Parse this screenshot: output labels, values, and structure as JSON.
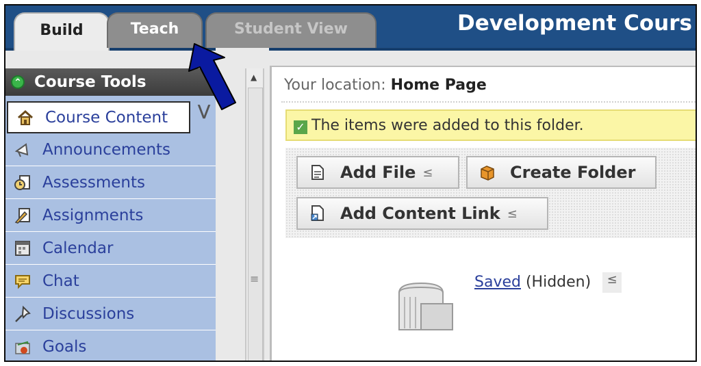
{
  "tabs": [
    {
      "label": "Build",
      "state": "active"
    },
    {
      "label": "Teach",
      "state": "inactive"
    },
    {
      "label": "Student View",
      "state": "disabled"
    }
  ],
  "course_title": "Development Cours",
  "sidebar": {
    "header": "Course Tools",
    "items": [
      {
        "label": "Course Content",
        "icon": "home-icon"
      },
      {
        "label": "Announcements",
        "icon": "megaphone-icon"
      },
      {
        "label": "Assessments",
        "icon": "clock-document-icon"
      },
      {
        "label": "Assignments",
        "icon": "pencil-document-icon"
      },
      {
        "label": "Calendar",
        "icon": "calendar-icon"
      },
      {
        "label": "Chat",
        "icon": "chat-bubble-icon"
      },
      {
        "label": "Discussions",
        "icon": "pushpin-icon"
      },
      {
        "label": "Goals",
        "icon": "target-icon"
      }
    ]
  },
  "location": {
    "prefix": "Your location:",
    "page": "Home Page"
  },
  "receipt": "The items were added to this folder.",
  "actions": {
    "add_file": "Add File",
    "create_folder": "Create Folder",
    "add_content_link": "Add Content Link"
  },
  "folder_item": {
    "name": "Saved",
    "status": "(Hidden)"
  },
  "colors": {
    "top_bar": "#1f4f86",
    "sidebar": "#aac0e2",
    "receipt_bg": "#fbf6a6",
    "link": "#2a3f9b",
    "arrow": "#0a1aa0"
  }
}
